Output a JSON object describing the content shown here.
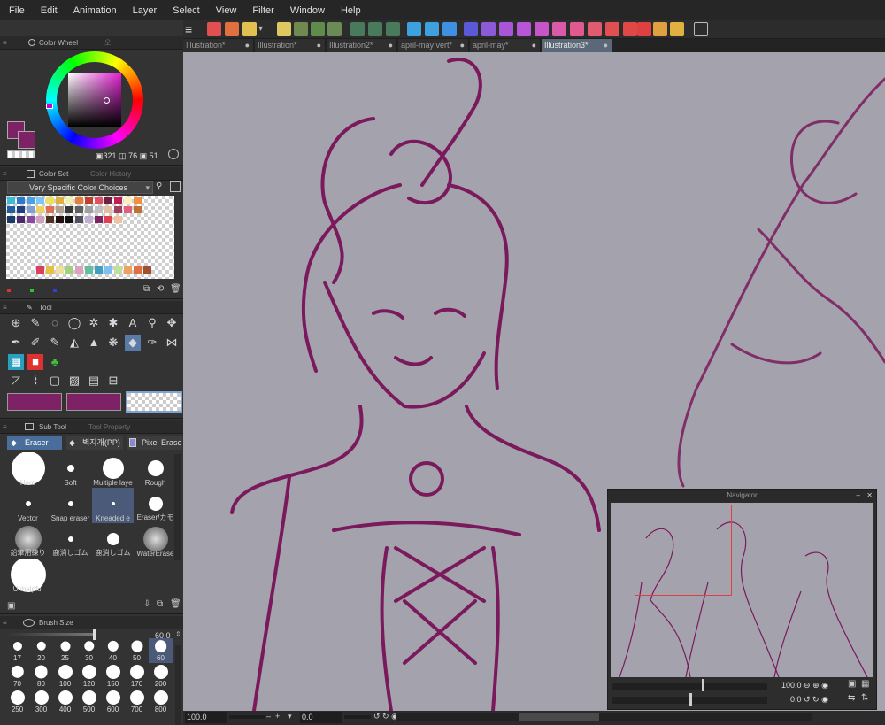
{
  "menu": [
    "File",
    "Edit",
    "Animation",
    "Layer",
    "Select",
    "View",
    "Filter",
    "Window",
    "Help"
  ],
  "tabs": [
    {
      "label": "Illustration*",
      "active": false
    },
    {
      "label": "Illustration*",
      "active": false
    },
    {
      "label": "Illustration2*",
      "active": false
    },
    {
      "label": "april-may vert*",
      "active": false
    },
    {
      "label": "april-may*",
      "active": false
    },
    {
      "label": "Illustration3*",
      "active": true
    }
  ],
  "color_wheel": {
    "title": "Color Wheel",
    "tab2": "오",
    "tab3": "",
    "h": "321",
    "s": "76",
    "v": "51",
    "main_color": "#7d2365",
    "sub_color": "#7d2365"
  },
  "color_set": {
    "title": "Color Set",
    "tab2": "Color History",
    "set_name": "Very Specific Color Choices"
  },
  "tool": {
    "title": "Tool",
    "color_main": "#7d2365",
    "color_sub": "#7d2365"
  },
  "sub_tool": {
    "title": "Sub Tool",
    "tab2": "Tool Property",
    "groups": [
      "Eraser",
      "벽지개(PP)",
      "Pixel Eraser"
    ],
    "items": [
      "Hard",
      "Soft",
      "Multiple laye",
      "Rough",
      "Vector",
      "Snap eraser",
      "Kneaded e",
      "Eraser/カモ",
      "鉛筆用練り",
      "鹿消しゴム",
      "鹿消しゴム",
      "WaterErase",
      "Unhelpful"
    ]
  },
  "brush_size": {
    "title": "Brush Size",
    "value": "60.0",
    "sizes": [
      "17",
      "20",
      "25",
      "30",
      "40",
      "50",
      "60",
      "70",
      "80",
      "100",
      "120",
      "150",
      "170",
      "200",
      "250",
      "300",
      "400",
      "500",
      "600",
      "700",
      "800"
    ],
    "selected": "60"
  },
  "navigator": {
    "title": "Navigator",
    "zoom": "100.0",
    "rotation": "0.0"
  },
  "status": {
    "zoom": "100.0",
    "angle": "0.0"
  },
  "colors": {
    "stroke": "#7a1a5c",
    "canvas": "#a4a2ad",
    "accent": "#5a6878"
  }
}
